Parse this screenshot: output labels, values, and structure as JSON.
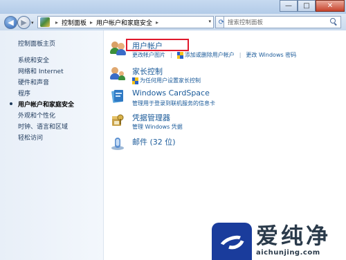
{
  "window": {
    "caption": {
      "minimize": "—",
      "maximize": "□",
      "close": "✕"
    }
  },
  "address": {
    "back": "◀",
    "forward": "▶",
    "segments": [
      "控制面板",
      "用户帐户和家庭安全"
    ],
    "separator": "▸"
  },
  "search": {
    "placeholder": "搜索控制面板"
  },
  "sidebar": {
    "items": [
      {
        "label": "控制面板主页",
        "current": false
      },
      {
        "label": "系统和安全",
        "current": false
      },
      {
        "label": "网络和 Internet",
        "current": false
      },
      {
        "label": "硬件和声音",
        "current": false
      },
      {
        "label": "程序",
        "current": false
      },
      {
        "label": "用户帐户和家庭安全",
        "current": true
      },
      {
        "label": "外观和个性化",
        "current": false
      },
      {
        "label": "时钟、语言和区域",
        "current": false
      },
      {
        "label": "轻松访问",
        "current": false
      }
    ]
  },
  "categories": [
    {
      "title": "用户帐户",
      "icon": "users-icon",
      "links": [
        "更改帐户图片",
        "添加或删除用户帐户",
        "更改 Windows 密码"
      ]
    },
    {
      "title": "家长控制",
      "icon": "parental-controls-icon",
      "links": [
        "为任何用户设置家长控制"
      ]
    },
    {
      "title": "Windows CardSpace",
      "icon": "cardspace-icon",
      "links": [
        "管理用于登录到联机服务的信息卡"
      ]
    },
    {
      "title": "凭据管理器",
      "icon": "credential-manager-icon",
      "links": [
        "管理 Windows 凭据"
      ]
    },
    {
      "title": "邮件 (32 位)",
      "icon": "mail-icon",
      "links": []
    }
  ],
  "watermark": {
    "text": "爱纯净",
    "url": "aichunjing.com"
  },
  "colors": {
    "link": "#1a5a99",
    "highlight": "#e0182b",
    "sidebar_text": "#1e395b"
  }
}
